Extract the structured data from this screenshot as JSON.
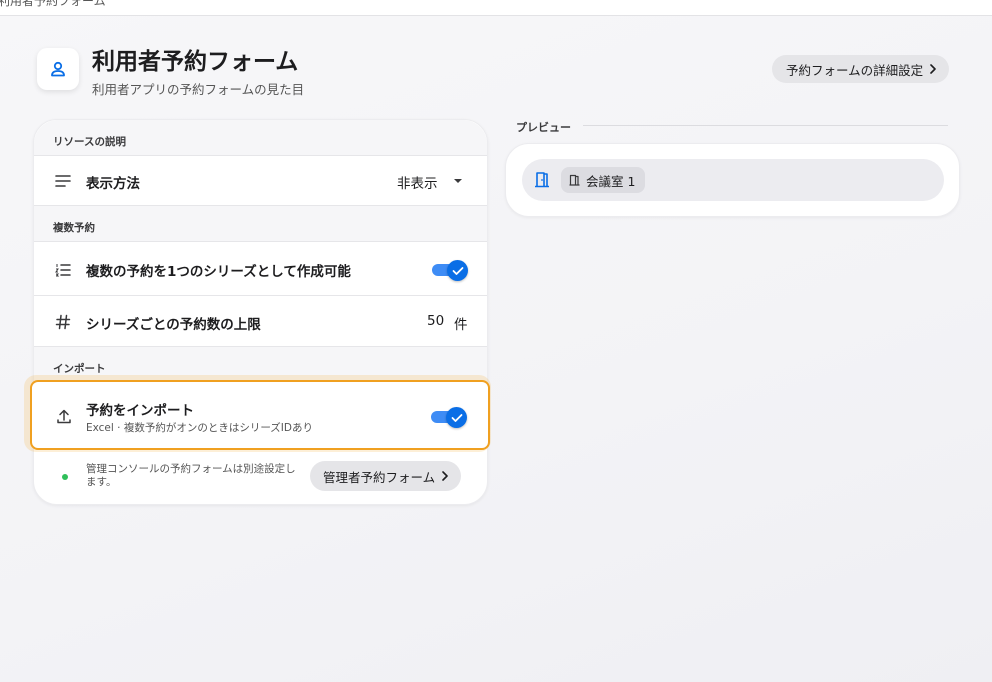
{
  "window": {
    "title": "利用者予約フォーム"
  },
  "header": {
    "title": "利用者予約フォーム",
    "subtitle": "利用者アプリの予約フォームの見た目",
    "detail_button": "予約フォームの詳細設定",
    "icon": "person-icon"
  },
  "settings": {
    "sections": {
      "resource_description": "リソースの説明",
      "multiple_booking": "複数予約",
      "import": "インポート"
    },
    "display_method": {
      "label": "表示方法",
      "value": "非表示",
      "icon": "lines-icon"
    },
    "series_booking": {
      "label": "複数の予約を1つのシリーズとして作成可能",
      "enabled": true,
      "icon": "numbered-list-icon"
    },
    "series_limit": {
      "label": "シリーズごとの予約数の上限",
      "value": "50",
      "unit": "件",
      "icon": "hash-icon"
    },
    "import_booking": {
      "label": "予約をインポート",
      "description": "Excel · 複数予約がオンのときはシリーズIDあり",
      "enabled": true,
      "icon": "upload-icon"
    },
    "footer": {
      "note": "管理コンソールの予約フォームは別途設定します。",
      "admin_button": "管理者予約フォーム"
    }
  },
  "preview": {
    "label": "プレビュー",
    "chip_label": "会議室 1",
    "icons": [
      "door-icon",
      "door-small-icon"
    ]
  },
  "colors": {
    "accent": "#0a6ee6",
    "toggle_track": "#3e8cf5",
    "highlight": "#f0a020",
    "status_dot": "#2fbf5a"
  }
}
